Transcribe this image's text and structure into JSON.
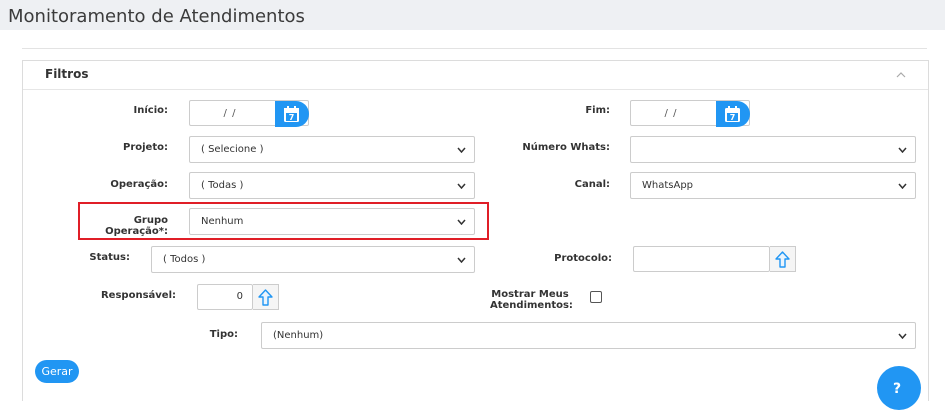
{
  "page": {
    "title": "Monitoramento de Atendimentos"
  },
  "filters": {
    "title": "Filtros",
    "inicio": {
      "label": "Início:",
      "value": "/ /"
    },
    "fim": {
      "label": "Fim:",
      "value": "/ /"
    },
    "projeto": {
      "label": "Projeto:",
      "value": "( Selecione )"
    },
    "numero_whats": {
      "label": "Número Whats:",
      "value": ""
    },
    "operacao": {
      "label": "Operação:",
      "value": "( Todas )"
    },
    "canal": {
      "label": "Canal:",
      "value": "WhatsApp"
    },
    "grupo_operacao": {
      "label": "Grupo Operação*:",
      "value": "Nenhum"
    },
    "status": {
      "label": "Status:",
      "value": "( Todos )"
    },
    "protocolo": {
      "label": "Protocolo:",
      "value": ""
    },
    "responsavel": {
      "label": "Responsável:",
      "value": "0"
    },
    "mostrar_meus": {
      "label_line1": "Mostrar Meus",
      "label_line2": "Atendimentos:",
      "checked": false
    },
    "tipo": {
      "label": "Tipo:",
      "value": "(Nenhum)"
    }
  },
  "actions": {
    "gerar_label": "Gerar",
    "help_label": "?"
  },
  "colors": {
    "accent": "#2196f3",
    "highlight": "#e01e27"
  },
  "icons": [
    "calendar-icon",
    "chevron-down-icon",
    "arrow-up-icon",
    "chevron-up-icon",
    "help-icon"
  ]
}
